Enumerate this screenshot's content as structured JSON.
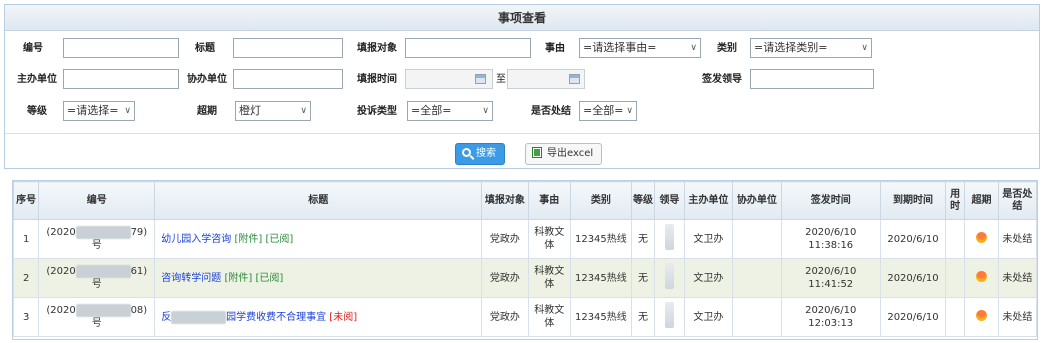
{
  "panel": {
    "title": "事项查看"
  },
  "form": {
    "code_label": "编号",
    "title_label": "标题",
    "target_label": "填报对象",
    "reason_label": "事由",
    "reason_value": "=请选择事由=",
    "category_label": "类别",
    "category_value": "=请选择类别=",
    "host_label": "主办单位",
    "assist_label": "协办单位",
    "fill_time_label": "填报时间",
    "to_label": "至",
    "leader_label": "签发领导",
    "level_label": "等级",
    "level_value": "=请选择=",
    "overdue_label": "超期",
    "overdue_value": "橙灯",
    "complaint_label": "投诉类型",
    "complaint_value": "=全部=",
    "closed_label": "是否处结",
    "closed_value": "=全部="
  },
  "actions": {
    "search_label": "搜索",
    "export_label": "导出excel"
  },
  "status_colors": {
    "overdue_orange": "#f2a01a",
    "unread": "#e02020",
    "attachment": "#2a8a3a",
    "title_link": "#1a3fd8"
  },
  "table": {
    "headers": {
      "seq": "序号",
      "code": "编号",
      "title": "标题",
      "target": "填报对象",
      "reason": "事由",
      "category": "类别",
      "level": "等级",
      "leader": "领导",
      "host": "主办单位",
      "assist": "协办单位",
      "sign_time": "签发时间",
      "due_time": "到期时间",
      "used_time": "用时",
      "overdue": "超期",
      "closed": "是否处结"
    },
    "rows": [
      {
        "seq": "1",
        "code_pre": "(2020",
        "code_post": "79)",
        "code_suffix": "号",
        "title_main": "幼儿园入学咨询",
        "tag_attach": "[附件]",
        "tag_status": "[已阅]",
        "target": "党政办",
        "reason": "科教文体",
        "category": "12345热线",
        "level": "无",
        "host": "文卫办",
        "assist": "",
        "sign_date": "2020/6/10",
        "sign_clock": "11:38:16",
        "due": "2020/6/10",
        "used": "",
        "closed": "未处结"
      },
      {
        "seq": "2",
        "code_pre": "(2020",
        "code_post": "61)",
        "code_suffix": "号",
        "title_main": "咨询转学问题",
        "tag_attach": "[附件]",
        "tag_status": "[已阅]",
        "target": "党政办",
        "reason": "科教文体",
        "category": "12345热线",
        "level": "无",
        "host": "文卫办",
        "assist": "",
        "sign_date": "2020/6/10",
        "sign_clock": "11:41:52",
        "due": "2020/6/10",
        "used": "",
        "closed": "未处结"
      },
      {
        "seq": "3",
        "code_pre": "(2020",
        "code_post": "08)",
        "code_suffix": "号",
        "title_main_pre": "反",
        "title_main_post": "园学费收费不合理事宜",
        "tag_unread": "[未阅]",
        "target": "党政办",
        "reason": "科教文体",
        "category": "12345热线",
        "level": "无",
        "host": "文卫办",
        "assist": "",
        "sign_date": "2020/6/10",
        "sign_clock": "12:03:13",
        "due": "2020/6/10",
        "used": "",
        "closed": "未处结"
      }
    ]
  }
}
